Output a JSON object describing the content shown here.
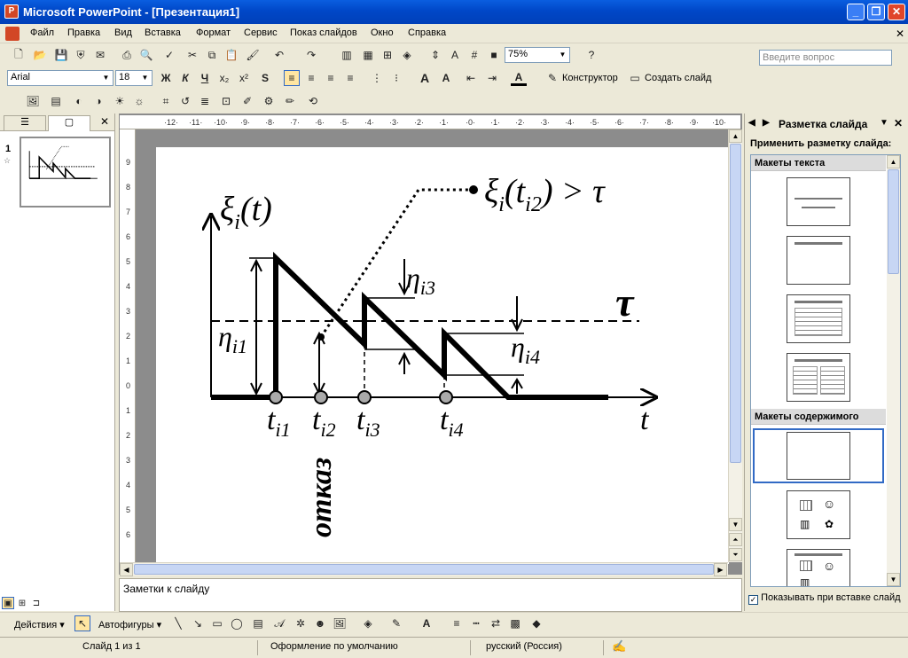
{
  "window": {
    "title": "Microsoft PowerPoint - [Презентация1]"
  },
  "menu": {
    "items": [
      "Файл",
      "Правка",
      "Вид",
      "Вставка",
      "Формат",
      "Сервис",
      "Показ слайдов",
      "Окно",
      "Справка"
    ]
  },
  "ask_box": {
    "placeholder": "Введите вопрос"
  },
  "toolbar": {
    "zoom": "75%",
    "font": "Arial",
    "font_size": "18",
    "bold": "Ж",
    "italic": "К",
    "underline": "Ч",
    "designer": "Конструктор",
    "new_slide": "Создать слайд"
  },
  "slides_pane": {
    "slide_number": "1"
  },
  "slide": {
    "y_label_main": "ξ",
    "y_label_sub": "i",
    "y_label_arg": "(t)",
    "top_label_main": "ξ",
    "top_label_sub": "i",
    "top_label_arg": "(t",
    "top_label_arg_sub": "i2",
    "top_label_rest": ") > τ",
    "tau": "τ",
    "x_axis": "t",
    "eta1": "η",
    "eta1_sub": "i1",
    "eta3": "η",
    "eta3_sub": "i3",
    "eta4": "η",
    "eta4_sub": "i4",
    "t1": "t",
    "t1_sub": "i1",
    "t2": "t",
    "t2_sub": "i2",
    "t3": "t",
    "t3_sub": "i3",
    "t4": "t",
    "t4_sub": "i4",
    "refusal": "отказ"
  },
  "notes": {
    "placeholder": "Заметки к слайду"
  },
  "task_pane": {
    "title": "Разметка слайда",
    "apply_label": "Применить разметку слайда:",
    "section_text": "Макеты текста",
    "section_content": "Макеты содержимого",
    "show_on_insert": "Показывать при вставке слайд"
  },
  "drawing": {
    "actions": "Действия",
    "autoshapes": "Автофигуры"
  },
  "status": {
    "slide": "Слайд 1 из 1",
    "design": "Оформление по умолчанию",
    "language": "русский (Россия)"
  },
  "colors": {
    "titlebar": "#0050d8",
    "workspace": "#8c8c8c",
    "selection": "#316ac5"
  }
}
